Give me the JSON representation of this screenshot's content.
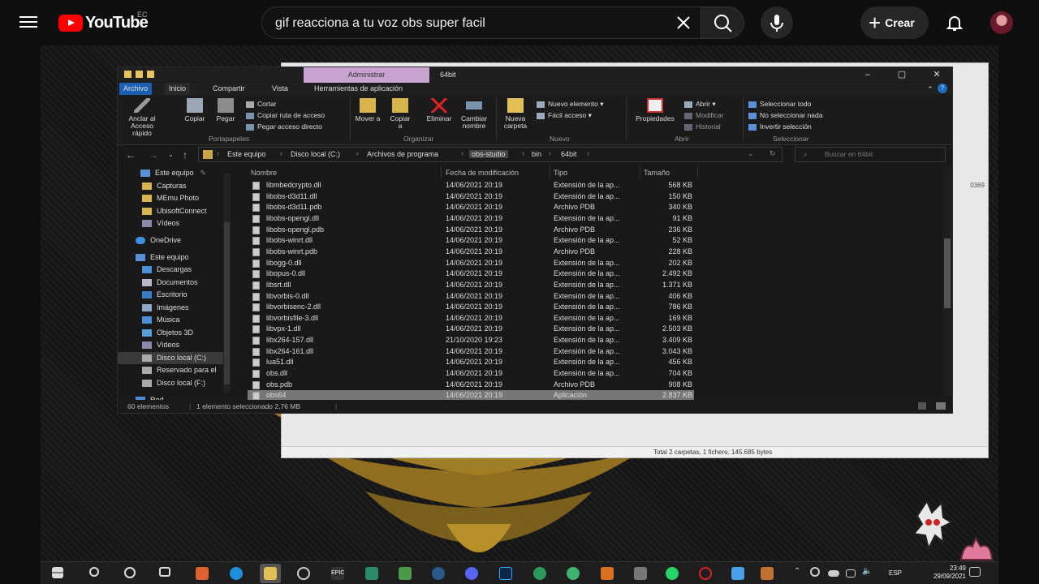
{
  "youtube": {
    "logo_text": "YouTube",
    "country": "EC",
    "search_query": "gif reacciona a tu voz obs super facil",
    "create_label": "Crear"
  },
  "explorer": {
    "admin_tab": "Administrar",
    "window_title": "64bit",
    "ribbon_tabs": [
      "Archivo",
      "Inicio",
      "Compartir",
      "Vista",
      "Herramientas de aplicación"
    ],
    "ribbon": {
      "pin_label": "Anclar al Acceso rápido",
      "copy_label": "Copiar",
      "paste_label": "Pegar",
      "cut_label": "Cortar",
      "copy_path_label": "Copiar ruta de acceso",
      "paste_shortcut_label": "Pegar acceso directo",
      "move_label": "Mover a",
      "copyto_label": "Copiar a",
      "delete_label": "Eliminar",
      "rename_label": "Cambiar nombre",
      "new_folder_label": "Nueva carpeta",
      "new_item_label": "Nuevo elemento",
      "easy_access_label": "Fácil acceso",
      "properties_label": "Propiedades",
      "open_label": "Abrir",
      "edit_label": "Modificar",
      "history_label": "Historial",
      "select_all_label": "Seleccionar todo",
      "select_none_label": "No seleccionar nada",
      "invert_label": "Invertir selección",
      "groups": [
        "Portapapeles",
        "Organizar",
        "Nuevo",
        "Abrir",
        "Seleccionar"
      ]
    },
    "breadcrumb": [
      "Este equipo",
      "Disco local (C:)",
      "Archivos de programa",
      "obs-studio",
      "bin",
      "64bit"
    ],
    "search_placeholder": "Buscar en 64bit",
    "nav": {
      "quick_access": "Este equipo",
      "items": [
        "Capturas",
        "MEmu Photo",
        "UbisoftConnect",
        "Vídeos",
        "OneDrive",
        "Este equipo",
        "Descargas",
        "Documentos",
        "Escritorio",
        "Imágenes",
        "Música",
        "Objetos 3D",
        "Vídeos",
        "Disco local (C:)",
        "Reservado para el",
        "Disco local (F:)",
        "Red"
      ]
    },
    "columns": [
      "Nombre",
      "Fecha de modificación",
      "Tipo",
      "Tamaño"
    ],
    "files": [
      [
        "libmbedcrypto.dll",
        "14/06/2021 20:19",
        "Extensión de la ap...",
        "568 KB"
      ],
      [
        "libobs-d3d11.dll",
        "14/06/2021 20:19",
        "Extensión de la ap...",
        "150 KB"
      ],
      [
        "libobs-d3d11.pdb",
        "14/06/2021 20:19",
        "Archivo PDB",
        "340 KB"
      ],
      [
        "libobs-opengl.dll",
        "14/06/2021 20:19",
        "Extensión de la ap...",
        "91 KB"
      ],
      [
        "libobs-opengl.pdb",
        "14/06/2021 20:19",
        "Archivo PDB",
        "236 KB"
      ],
      [
        "libobs-winrt.dll",
        "14/06/2021 20:19",
        "Extensión de la ap...",
        "52 KB"
      ],
      [
        "libobs-winrt.pdb",
        "14/06/2021 20:19",
        "Archivo PDB",
        "228 KB"
      ],
      [
        "libogg-0.dll",
        "14/06/2021 20:19",
        "Extensión de la ap...",
        "202 KB"
      ],
      [
        "libopus-0.dll",
        "14/06/2021 20:19",
        "Extensión de la ap...",
        "2.492 KB"
      ],
      [
        "libsrt.dll",
        "14/06/2021 20:19",
        "Extensión de la ap...",
        "1.371 KB"
      ],
      [
        "libvorbis-0.dll",
        "14/06/2021 20:19",
        "Extensión de la ap...",
        "406 KB"
      ],
      [
        "libvorbisenc-2.dll",
        "14/06/2021 20:19",
        "Extensión de la ap...",
        "786 KB"
      ],
      [
        "libvorbisfile-3.dll",
        "14/06/2021 20:19",
        "Extensión de la ap...",
        "169 KB"
      ],
      [
        "libvpx-1.dll",
        "14/06/2021 20:19",
        "Extensión de la ap...",
        "2.503 KB"
      ],
      [
        "libx264-157.dll",
        "21/10/2020 19:23",
        "Extensión de la ap...",
        "3.409 KB"
      ],
      [
        "libx264-161.dll",
        "14/06/2021 20:19",
        "Extensión de la ap...",
        "3.043 KB"
      ],
      [
        "lua51.dll",
        "14/06/2021 20:19",
        "Extensión de la ap...",
        "456 KB"
      ],
      [
        "obs.dll",
        "14/06/2021 20:19",
        "Extensión de la ap...",
        "704 KB"
      ],
      [
        "obs.pdb",
        "14/06/2021 20:19",
        "Archivo PDB",
        "908 KB"
      ],
      [
        "obs64",
        "14/06/2021 20:19",
        "Aplicación",
        "2.837 KB"
      ]
    ],
    "status_count": "60 elementos",
    "status_selected": "1 elemento seleccionado  2,76 MB"
  },
  "bg_window": {
    "status": "Total 2 carpetas, 1 fichero, 145.685 bytes",
    "num": "0369"
  },
  "taskbar": {
    "lang": "ESP",
    "time": "23:49",
    "date": "29/09/2021"
  },
  "colors": {
    "youtube_red": "#ff0000",
    "admin_tab": "#c9a3cf",
    "emblem_gold": "#b8902a"
  }
}
